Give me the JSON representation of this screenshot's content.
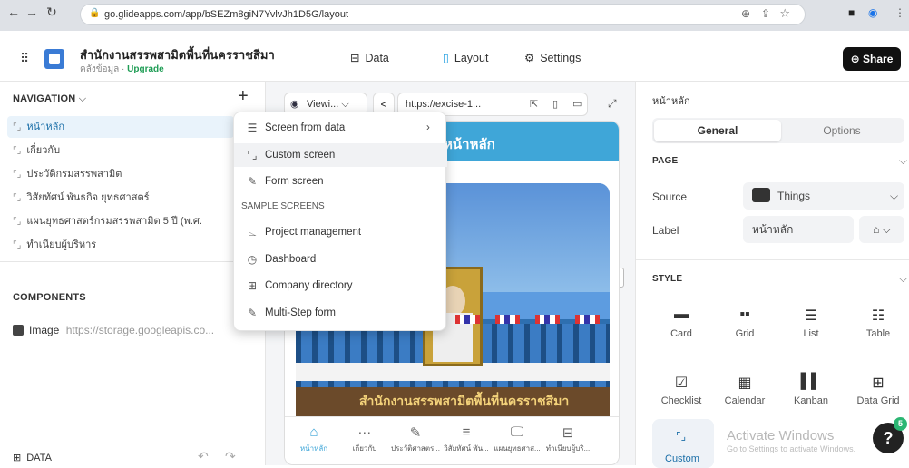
{
  "browser": {
    "url": "go.glideapps.com/app/bSEZm8giN7YvlvJh1D5G/layout",
    "back_icon": "arrow-left",
    "forward_icon": "arrow-right",
    "reload_icon": "reload"
  },
  "header": {
    "app_name": "สำนักงานสรรพสามิตพื้นที่นครราชสีมา",
    "subtitle": "คลังข้อมูล",
    "upgrade": "Upgrade",
    "tabs": [
      {
        "label": "Data",
        "icon": "table-icon"
      },
      {
        "label": "Layout",
        "icon": "layout-icon",
        "active": true
      },
      {
        "label": "Settings",
        "icon": "gear-icon"
      }
    ],
    "share_label": "Share"
  },
  "left": {
    "navigation_title": "NAVIGATION",
    "nav_items": [
      "หน้าหลัก",
      "เกี่ยวกับ",
      "ประวัติกรมสรรพสามิต",
      "วิสัยทัศน์ พันธกิจ ยุทธศาสตร์",
      "แผนยุทธศาสตร์กรมสรรพสามิต 5 ปี (พ.ศ.",
      "ทำเนียบผู้บริหาร"
    ],
    "components_title": "COMPONENTS",
    "component_item": {
      "type": "Image",
      "value": "https://storage.googleapis.co..."
    },
    "data_label": "DATA"
  },
  "menu": {
    "items": [
      {
        "label": "Screen from data",
        "icon": "table-icon",
        "has_arrow": true
      },
      {
        "label": "Custom screen",
        "icon": "brackets-icon"
      },
      {
        "label": "Form screen",
        "icon": "pen-icon"
      }
    ],
    "sample_title": "SAMPLE SCREENS",
    "samples": [
      {
        "label": "Project management",
        "icon": "chart-icon"
      },
      {
        "label": "Dashboard",
        "icon": "clock-icon"
      },
      {
        "label": "Company directory",
        "icon": "grid-icon"
      },
      {
        "label": "Multi-Step form",
        "icon": "edit-icon"
      }
    ]
  },
  "preview": {
    "view_label": "Viewi...",
    "url": "https://excise-1...",
    "screen_title": "หน้าหลัก",
    "banner_text": "สำนักงานสรรพสามิตพื้นที่นครราชสีมา",
    "tabbar": [
      {
        "label": "หน้าหลัก",
        "icon": "home-icon"
      },
      {
        "label": "เกี่ยวกับ",
        "icon": "dots-icon"
      },
      {
        "label": "ประวัติศาสตร...",
        "icon": "edit-icon"
      },
      {
        "label": "วิสัยทัศน์ พัน...",
        "icon": "list-icon"
      },
      {
        "label": "แผนยุทธศาส...",
        "icon": "monitor-icon"
      },
      {
        "label": "ทำเนียบผู้บริ...",
        "icon": "table-icon"
      }
    ],
    "colors": {
      "accent": "#3fa6d8",
      "sky": "#5d9ce0"
    }
  },
  "right": {
    "title": "หน้าหลัก",
    "tabs": [
      "General",
      "Options"
    ],
    "page_title": "PAGE",
    "source_label": "Source",
    "source_value": "Things",
    "label_label": "Label",
    "label_value": "หน้าหลัก",
    "style_title": "STYLE",
    "styles": [
      "Card",
      "Grid",
      "List",
      "Table",
      "Checklist",
      "Calendar",
      "Kanban",
      "Data Grid",
      "Custom"
    ],
    "watermark_title": "Activate Windows",
    "watermark_sub": "Go to Settings to activate Windows.",
    "badge_count": "5"
  }
}
